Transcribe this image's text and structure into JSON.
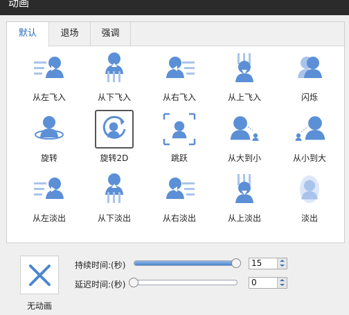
{
  "window": {
    "title": "动画"
  },
  "tabs": [
    {
      "label": "默认",
      "active": true
    },
    {
      "label": "退场",
      "active": false
    },
    {
      "label": "强调",
      "active": false
    }
  ],
  "effects": [
    {
      "label": "从左飞入",
      "icon": "fly-in-left-icon"
    },
    {
      "label": "从下飞入",
      "icon": "fly-in-bottom-icon"
    },
    {
      "label": "从右飞入",
      "icon": "fly-in-right-icon"
    },
    {
      "label": "从上飞入",
      "icon": "fly-in-top-icon"
    },
    {
      "label": "闪烁",
      "icon": "flash-icon"
    },
    {
      "label": "旋转",
      "icon": "spin-icon"
    },
    {
      "label": "旋转2D",
      "icon": "rotate-2d-icon",
      "selected": true
    },
    {
      "label": "跳跃",
      "icon": "jump-icon"
    },
    {
      "label": "从大到小",
      "icon": "shrink-icon"
    },
    {
      "label": "从小到大",
      "icon": "grow-icon"
    },
    {
      "label": "从左淡出",
      "icon": "fade-out-left-icon"
    },
    {
      "label": "从下淡出",
      "icon": "fade-out-bottom-icon"
    },
    {
      "label": "从右淡出",
      "icon": "fade-out-right-icon"
    },
    {
      "label": "从上淡出",
      "icon": "fade-out-top-icon"
    },
    {
      "label": "淡出",
      "icon": "fade-out-icon"
    }
  ],
  "no_animation": {
    "label": "无动画"
  },
  "duration": {
    "label": "持续时间:(秒)",
    "value": "15",
    "slider_fraction": 1.0
  },
  "delay": {
    "label": "延迟时间:(秒)",
    "value": "0",
    "slider_fraction": 0.0
  },
  "colors": {
    "accent": "#2a6fbe",
    "figure": "#5b8fd6",
    "figure_light": "#a9c4ec"
  }
}
